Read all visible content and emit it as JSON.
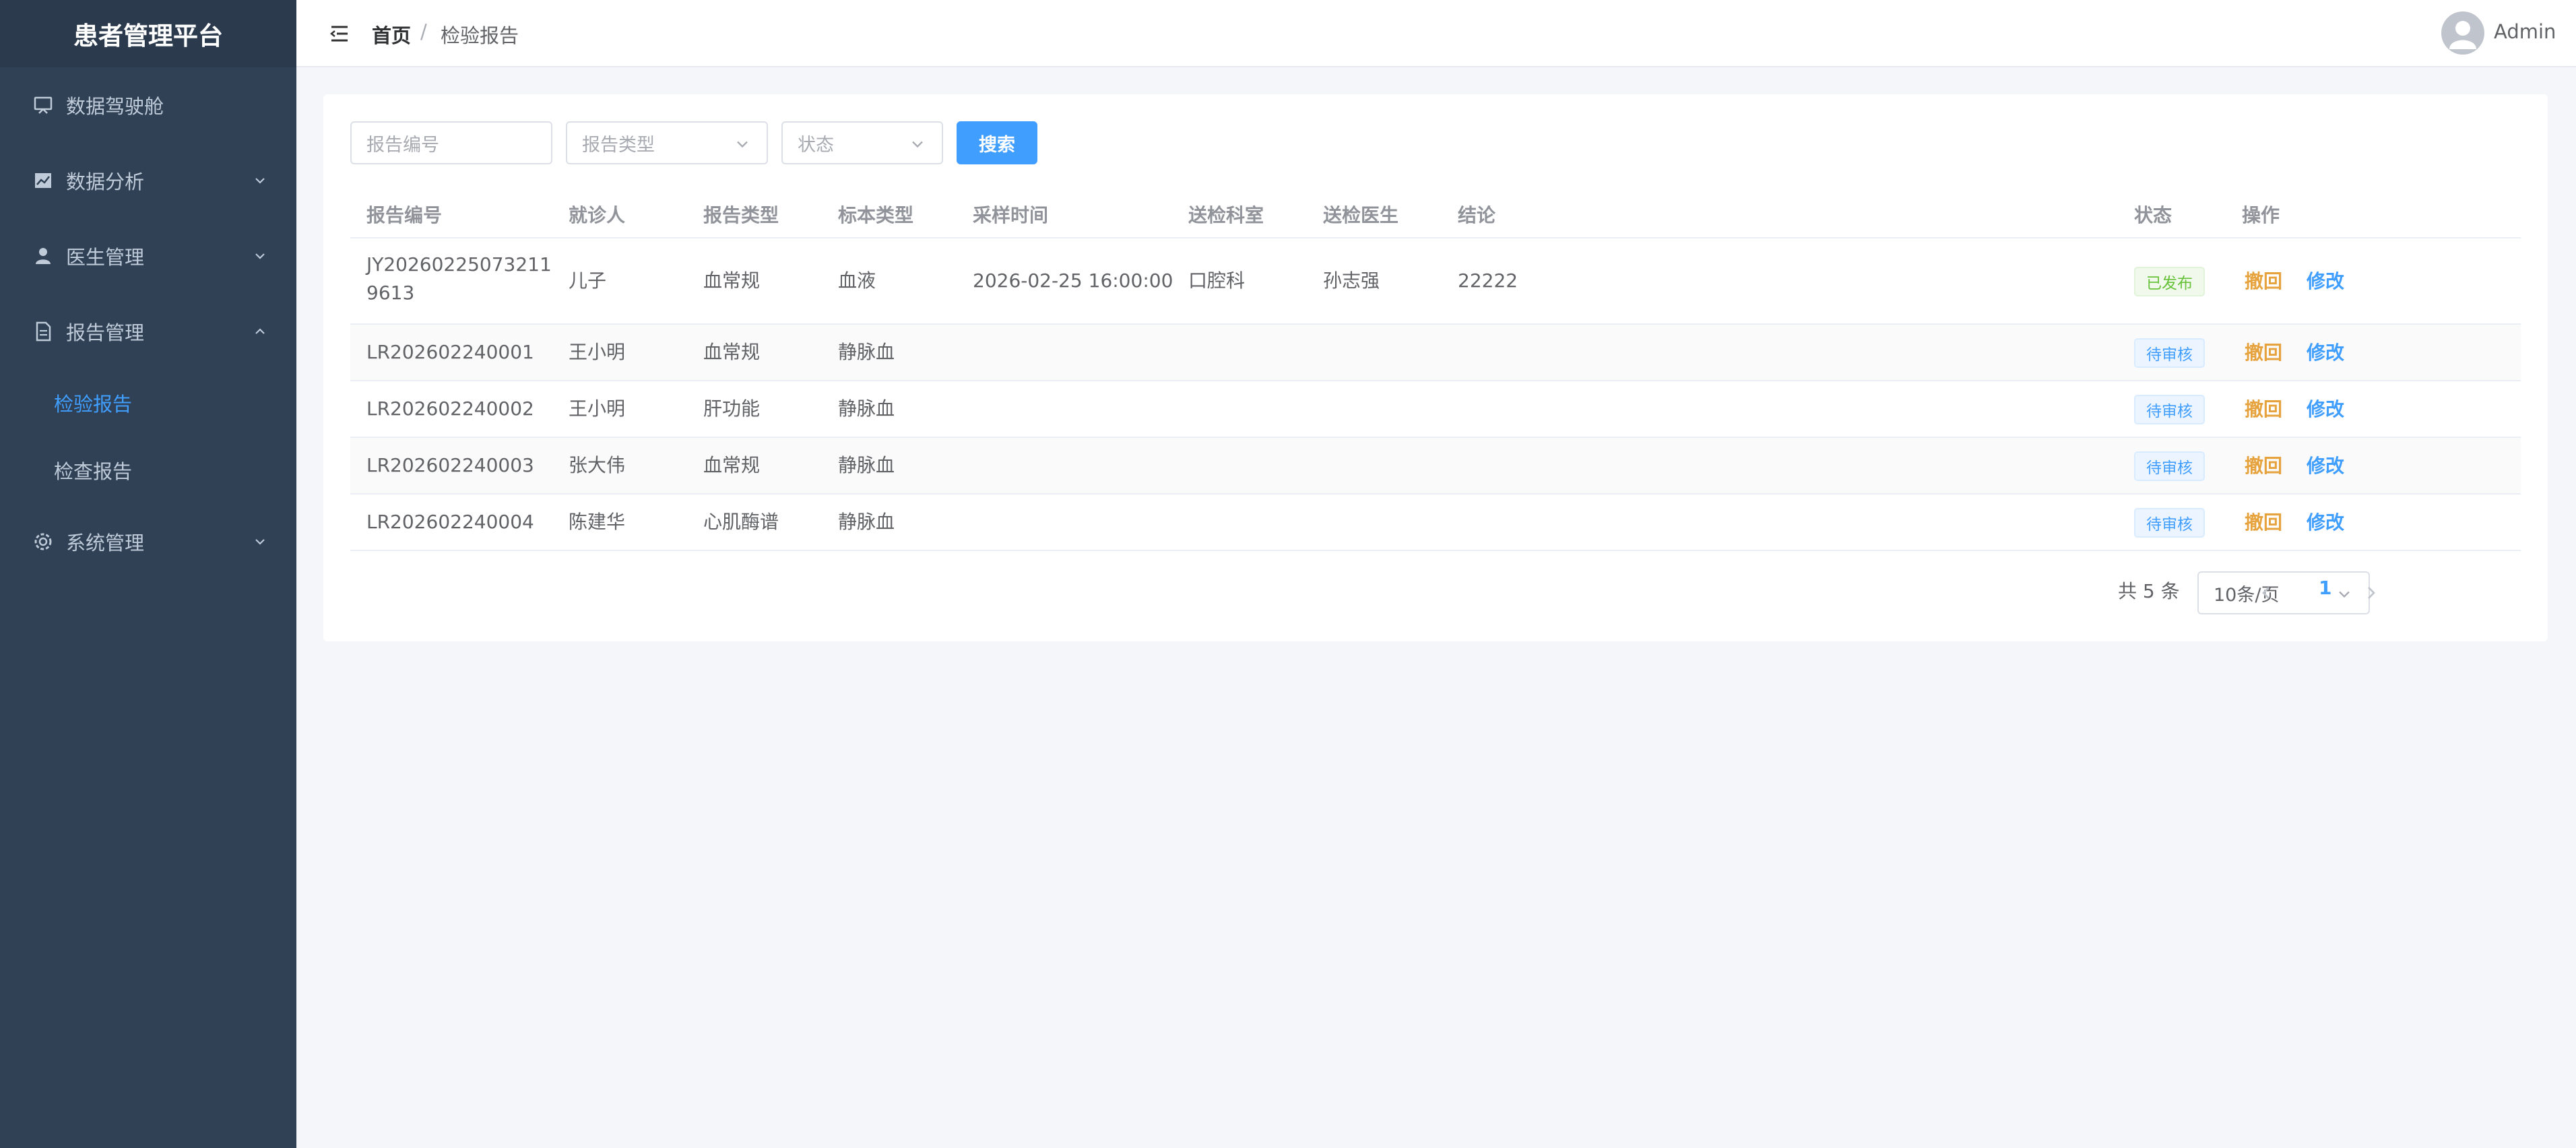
{
  "app": {
    "title": "患者管理平台"
  },
  "sidebar": {
    "items": [
      {
        "label": "数据驾驶舱",
        "icon": "monitor-icon"
      },
      {
        "label": "数据分析",
        "icon": "chart-icon"
      },
      {
        "label": "医生管理",
        "icon": "user-icon"
      },
      {
        "label": "报告管理",
        "icon": "document-icon"
      },
      {
        "label": "系统管理",
        "icon": "gear-icon"
      }
    ],
    "subitems": [
      {
        "label": "检验报告",
        "active": true
      },
      {
        "label": "检查报告",
        "active": false
      }
    ],
    "active_color": "#409eff"
  },
  "header": {
    "breadcrumb": {
      "home": "首页",
      "separator": "/",
      "current": "检验报告"
    },
    "user": "Admin"
  },
  "filters": {
    "report_no_placeholder": "报告编号",
    "report_type_placeholder": "报告类型",
    "status_placeholder": "状态",
    "search_label": "搜索"
  },
  "table": {
    "columns": [
      "报告编号",
      "就诊人",
      "报告类型",
      "标本类型",
      "采样时间",
      "送检科室",
      "送检医生",
      "结论",
      "状态",
      "操作"
    ],
    "rows": [
      {
        "report_no_line1": "JY20260225073211",
        "report_no_line2": "9613",
        "patient": "儿子",
        "type": "血常规",
        "specimen": "血液",
        "sample_time": "2026-02-25 16:00:00",
        "dept": "口腔科",
        "doctor": "孙志强",
        "conclusion": "22222",
        "status": "已发布"
      },
      {
        "report_no": "LR202602240001",
        "patient": "王小明",
        "type": "血常规",
        "specimen": "静脉血",
        "sample_time": "",
        "dept": "",
        "doctor": "",
        "conclusion": "",
        "status": "待审核"
      },
      {
        "report_no": "LR202602240002",
        "patient": "王小明",
        "type": "肝功能",
        "specimen": "静脉血",
        "sample_time": "",
        "dept": "",
        "doctor": "",
        "conclusion": "",
        "status": "待审核"
      },
      {
        "report_no": "LR202602240003",
        "patient": "张大伟",
        "type": "血常规",
        "specimen": "静脉血",
        "sample_time": "",
        "dept": "",
        "doctor": "",
        "conclusion": "",
        "status": "待审核"
      },
      {
        "report_no": "LR202602240004",
        "patient": "陈建华",
        "type": "心肌酶谱",
        "specimen": "静脉血",
        "sample_time": "",
        "dept": "",
        "doctor": "",
        "conclusion": "",
        "status": "待审核"
      }
    ],
    "actions": {
      "revoke": "撤回",
      "edit": "修改"
    }
  },
  "pagination": {
    "total": "共 5 条",
    "page_size": "10条/页",
    "current_page": "1"
  },
  "colors": {
    "primary": "#409eff",
    "warning": "#e6a23c",
    "success": "#67c23a",
    "sidebar_bg": "#304156"
  }
}
